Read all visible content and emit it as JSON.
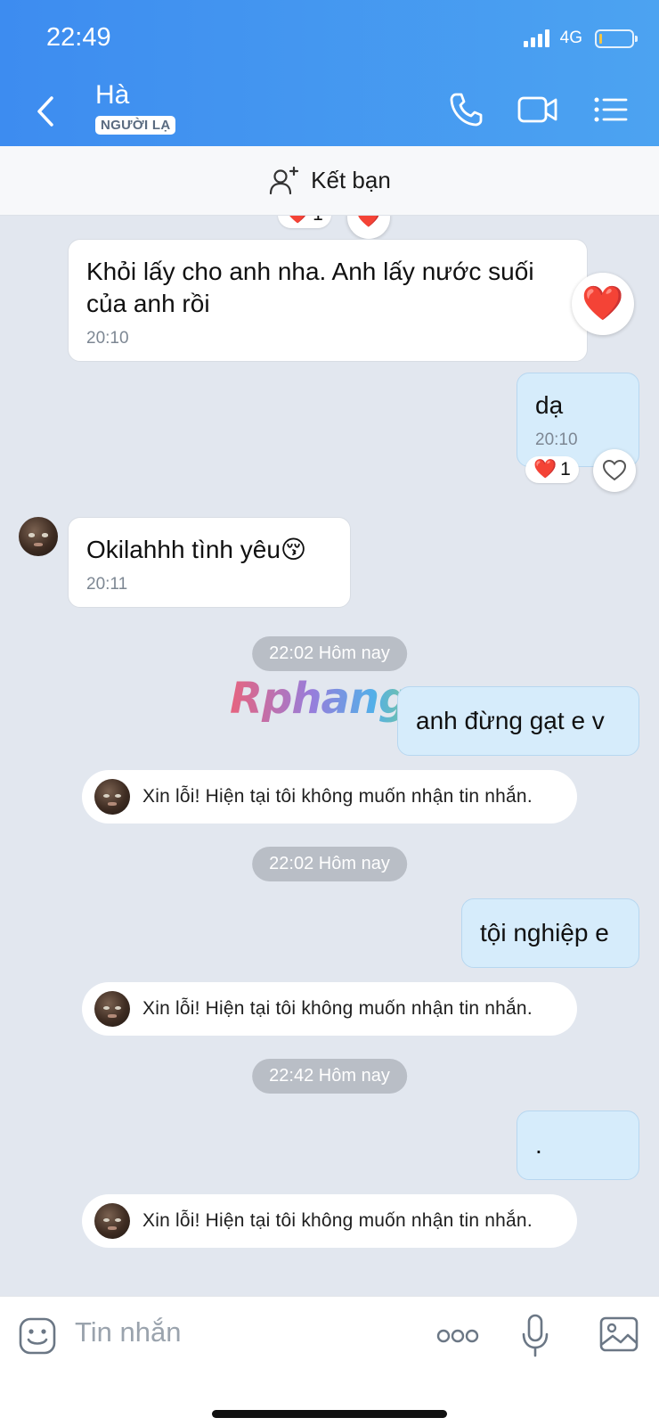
{
  "status_bar": {
    "time": "22:49",
    "network": "4G"
  },
  "header": {
    "contact_name": "Hà",
    "badge": "NGƯỜI LẠ",
    "icons": [
      "back-chevron-icon",
      "phone-icon",
      "video-call-icon",
      "menu-list-icon"
    ]
  },
  "friend_bar": {
    "label": "Kết bạn",
    "icon": "add-friend-icon"
  },
  "messages": [
    {
      "direction": "in",
      "text": "Khỏi lấy cho anh nha. Anh lấy nước suối của anh rồi",
      "time": "20:10",
      "reaction": "❤️"
    },
    {
      "direction": "out",
      "text": "dạ",
      "time": "20:10",
      "reaction_emoji": "❤️",
      "reaction_count": "1"
    },
    {
      "direction": "in",
      "text": "Okilahhh tình yêu😚",
      "time": "20:11"
    }
  ],
  "top_partial_reaction": {
    "emoji": "❤️",
    "count": "1"
  },
  "separators": [
    "22:02 Hôm nay",
    "22:02 Hôm nay",
    "22:42 Hôm nay"
  ],
  "later_messages": [
    {
      "direction": "out",
      "text": "anh đừng gạt e v"
    },
    {
      "direction": "out",
      "text": "tội nghiệp e"
    },
    {
      "direction": "out",
      "text": "."
    }
  ],
  "system_notice": "Xin lỗi! Hiện tại tôi không muốn nhận tin nhắn.",
  "watermark": "Rphangx",
  "input_bar": {
    "placeholder": "Tin nhắn",
    "icons": [
      "emoji-sticker-icon",
      "more-dots-icon",
      "microphone-icon",
      "image-gallery-icon"
    ]
  },
  "colors": {
    "header_start": "#3d8cf0",
    "header_end": "#4ca3f1",
    "outgoing_bubble": "#d6ecfb",
    "chat_bg": "#e2e7ef"
  }
}
